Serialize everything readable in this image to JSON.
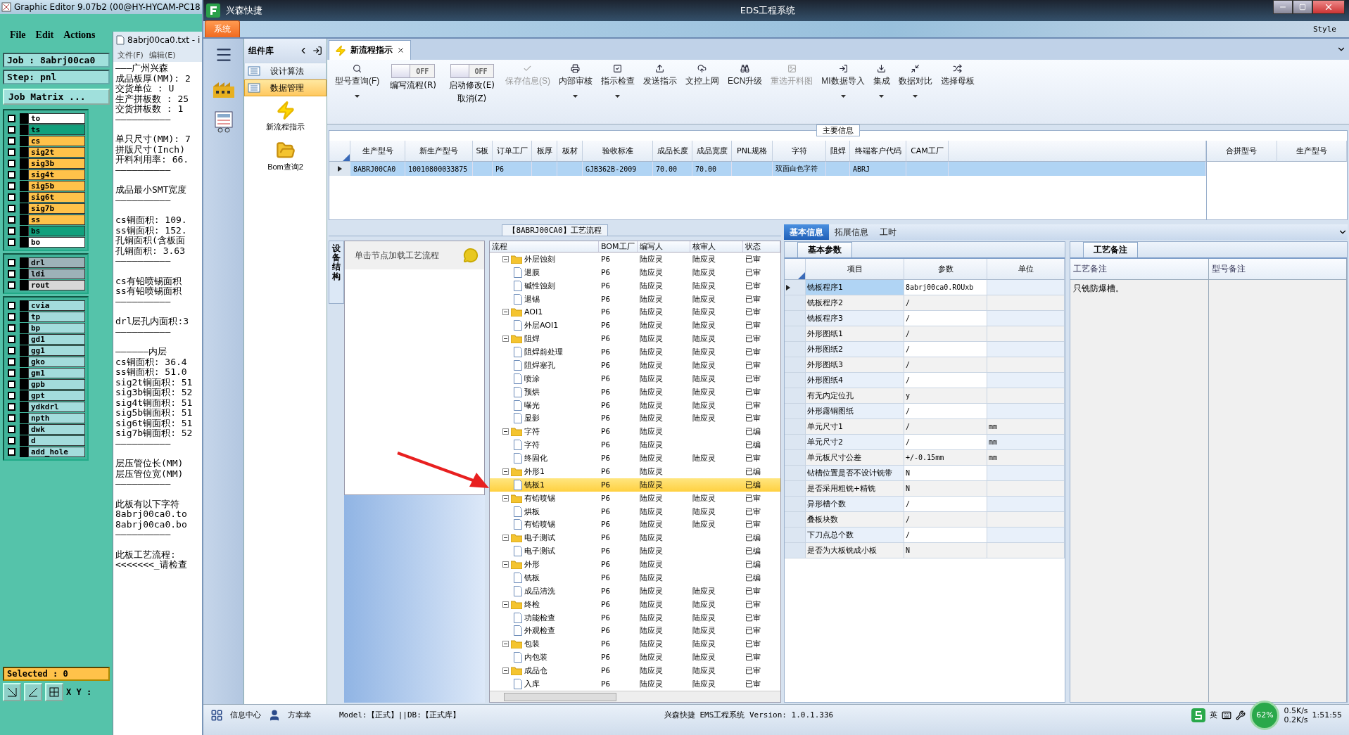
{
  "graphic_editor": {
    "title": "Graphic Editor 9.07b2 (00@HY-HYCAM-PC18",
    "menu": [
      "File",
      "Edit",
      "Actions"
    ],
    "job": "Job : 8abrj00ca0",
    "step": "Step: pnl",
    "matrix_button": "Job Matrix ...",
    "layer_groups": [
      [
        {
          "name": "to",
          "color": "#ffffff",
          "checked": false
        },
        {
          "name": "ts",
          "color": "#12a07c",
          "checked": false
        },
        {
          "name": "cs",
          "color": "#ffc24a",
          "checked": false
        },
        {
          "name": "sig2t",
          "color": "#ffc24a",
          "checked": false
        },
        {
          "name": "sig3b",
          "color": "#ffc24a",
          "checked": false
        },
        {
          "name": "sig4t",
          "color": "#ffc24a",
          "checked": false
        },
        {
          "name": "sig5b",
          "color": "#ffc24a",
          "checked": false
        },
        {
          "name": "sig6t",
          "color": "#ffc24a",
          "checked": false
        },
        {
          "name": "sig7b",
          "color": "#ffc24a",
          "checked": false
        },
        {
          "name": "ss",
          "color": "#ffc24a",
          "checked": false
        },
        {
          "name": "bs",
          "color": "#12a07c",
          "checked": false
        },
        {
          "name": "bo",
          "color": "#ffffff",
          "checked": false
        }
      ],
      [
        {
          "name": "drl",
          "color": "#9db2b8",
          "checked": false
        },
        {
          "name": "ldi",
          "color": "#9db2b8",
          "checked": false
        },
        {
          "name": "rout",
          "color": "#d8d8d8",
          "checked": false
        }
      ],
      [
        {
          "name": "cvia",
          "color": "#a3dcdc",
          "checked": false
        },
        {
          "name": "tp",
          "color": "#a3dcdc",
          "checked": false
        },
        {
          "name": "bp",
          "color": "#a3dcdc",
          "checked": false
        },
        {
          "name": "gd1",
          "color": "#a3dcdc",
          "checked": false
        },
        {
          "name": "gg1",
          "color": "#a3dcdc",
          "checked": false
        },
        {
          "name": "gko",
          "color": "#a3dcdc",
          "checked": false
        },
        {
          "name": "gm1",
          "color": "#a3dcdc",
          "checked": false
        },
        {
          "name": "gpb",
          "color": "#a3dcdc",
          "checked": false
        },
        {
          "name": "gpt",
          "color": "#a3dcdc",
          "checked": false
        },
        {
          "name": "ydkdrl",
          "color": "#a3dcdc",
          "checked": false
        },
        {
          "name": "npth",
          "color": "#a3dcdc",
          "checked": false
        },
        {
          "name": "dwk",
          "color": "#a3dcdc",
          "checked": false
        },
        {
          "name": "d",
          "color": "#a3dcdc",
          "checked": false
        },
        {
          "name": "add_hole",
          "color": "#a3dcdc",
          "checked": false
        }
      ]
    ],
    "selected": "Selected : 0",
    "xy_label": "X Y :"
  },
  "text_window": {
    "title": "8abrj00ca0.txt - i",
    "menu": [
      "文件(F)",
      "编辑(E)"
    ],
    "blocks": [
      [
        "———广州兴森",
        "成品板厚(MM): 2",
        "交货单位 : U",
        "生产拼板数 : 25",
        "交货拼板数 : 1",
        "——————————"
      ],
      [
        "单只尺寸(MM): 7",
        "拼版尺寸(Inch)",
        "开料利用率: 66.",
        "——————————"
      ],
      [
        "成品最小SMT宽度",
        "——————————"
      ],
      [
        "cs铜面积: 109.",
        "ss铜面积: 152.",
        "孔铜面积(含板面",
        "孔铜面积: 3.63",
        "——————————"
      ],
      [
        "cs有铅喷锡面积",
        "ss有铅喷锡面积",
        "——————————"
      ],
      [
        "drl层孔内面积:3",
        "——————————"
      ],
      [
        "——————内层",
        "cs铜面积: 36.4",
        "ss铜面积: 51.0",
        "sig2t铜面积: 51",
        "sig3b铜面积: 52",
        "sig4t铜面积: 51",
        "sig5b铜面积: 51",
        "sig6t铜面积: 51",
        "sig7b铜面积: 52",
        "——————————"
      ],
      [
        "层压管位长(MM)",
        "层压管位宽(MM)",
        "——————————"
      ],
      [
        "此板有以下字符",
        "8abrj00ca0.to",
        "8abrj00ca0.bo",
        "——————————"
      ],
      [
        "此板工艺流程: ",
        "<<<<<<<_请检查"
      ]
    ]
  },
  "eds": {
    "app_name": "兴森快捷",
    "title": "EDS工程系统",
    "style_label": "Style",
    "ribbon_tab": "系统",
    "components": {
      "title": "组件库",
      "items": [
        {
          "label": "设计算法",
          "selected": false
        },
        {
          "label": "数据管理",
          "selected": true
        }
      ],
      "tools": [
        "新流程指示",
        "Bom查询2"
      ]
    },
    "doc_tab": "新流程指示",
    "toolbar": [
      {
        "kind": "button",
        "label": "型号查询(F)",
        "disabled": false,
        "dropdown": true
      },
      {
        "kind": "toggle",
        "label": "编写流程(R)",
        "state_text": "OFF",
        "on": false
      },
      {
        "kind": "toggle",
        "label": "启动修改(E)",
        "label2": "取消(Z)",
        "state_text": "OFF",
        "on": false
      },
      {
        "kind": "button",
        "label": "保存信息(S)",
        "disabled": true,
        "dropdown": false
      },
      {
        "kind": "button",
        "label": "内部审核",
        "disabled": false,
        "dropdown": true
      },
      {
        "kind": "button",
        "label": "指示检查",
        "disabled": false,
        "dropdown": true
      },
      {
        "kind": "button",
        "label": "发送指示",
        "disabled": false,
        "dropdown": false
      },
      {
        "kind": "button",
        "label": "文控上网",
        "disabled": false,
        "dropdown": false
      },
      {
        "kind": "button",
        "label": "ECN升级",
        "disabled": false,
        "dropdown": false
      },
      {
        "kind": "button",
        "label": "重选开料图",
        "disabled": true,
        "dropdown": false
      },
      {
        "kind": "button",
        "label": "MI数据导入",
        "disabled": false,
        "dropdown": true
      },
      {
        "kind": "button",
        "label": "集成",
        "disabled": false,
        "dropdown": true
      },
      {
        "kind": "button",
        "label": "数据对比",
        "disabled": false,
        "dropdown": true
      },
      {
        "kind": "button",
        "label": "选择母板",
        "disabled": false,
        "dropdown": false
      }
    ],
    "main_info": {
      "title": "主要信息",
      "columns": [
        "生产型号",
        "新生产型号",
        "S板",
        "订单工厂",
        "板厚",
        "板材",
        "验收标准",
        "成品长度",
        "成品宽度",
        "PNL规格",
        "字符",
        "阻焊",
        "终端客户代码",
        "CAM工厂"
      ],
      "rows": [
        {
          "selected": true,
          "cells": [
            "8ABRJ00CA0",
            "10010800033875",
            "",
            "P6",
            "",
            "",
            "GJB362B-2009",
            "70.00",
            "70.00",
            "",
            "双面白色字符",
            "",
            "ABRJ",
            ""
          ]
        }
      ],
      "side_columns": [
        "合拼型号",
        "生产型号"
      ]
    },
    "side_tab": "设备结构",
    "hint": "单击节点加载工艺流程",
    "flow": {
      "title": "【8ABRJ00CA0】工艺流程",
      "columns": [
        "流程",
        "BOM工厂",
        "编写人",
        "核审人",
        "状态"
      ],
      "nodes": [
        {
          "label": "外层蚀刻",
          "factory": "P6",
          "writer": "陆应灵",
          "reviewer": "陆应灵",
          "status": "已审",
          "selected": false,
          "children": [
            {
              "label": "退膜",
              "factory": "P6",
              "writer": "陆应灵",
              "reviewer": "陆应灵",
              "status": "已审",
              "selected": false
            },
            {
              "label": "碱性蚀刻",
              "factory": "P6",
              "writer": "陆应灵",
              "reviewer": "陆应灵",
              "status": "已审",
              "selected": false
            },
            {
              "label": "退锡",
              "factory": "P6",
              "writer": "陆应灵",
              "reviewer": "陆应灵",
              "status": "已审",
              "selected": false
            }
          ]
        },
        {
          "label": "AOI1",
          "factory": "P6",
          "writer": "陆应灵",
          "reviewer": "陆应灵",
          "status": "已审",
          "selected": false,
          "children": [
            {
              "label": "外层AOI1",
              "factory": "P6",
              "writer": "陆应灵",
              "reviewer": "陆应灵",
              "status": "已审",
              "selected": false
            }
          ]
        },
        {
          "label": "阻焊",
          "factory": "P6",
          "writer": "陆应灵",
          "reviewer": "陆应灵",
          "status": "已审",
          "selected": false,
          "children": [
            {
              "label": "阻焊前处理",
              "factory": "P6",
              "writer": "陆应灵",
              "reviewer": "陆应灵",
              "status": "已审",
              "selected": false
            },
            {
              "label": "阻焊塞孔",
              "factory": "P6",
              "writer": "陆应灵",
              "reviewer": "陆应灵",
              "status": "已审",
              "selected": false
            },
            {
              "label": "喷涂",
              "factory": "P6",
              "writer": "陆应灵",
              "reviewer": "陆应灵",
              "status": "已审",
              "selected": false
            },
            {
              "label": "预烘",
              "factory": "P6",
              "writer": "陆应灵",
              "reviewer": "陆应灵",
              "status": "已审",
              "selected": false
            },
            {
              "label": "曝光",
              "factory": "P6",
              "writer": "陆应灵",
              "reviewer": "陆应灵",
              "status": "已审",
              "selected": false
            },
            {
              "label": "显影",
              "factory": "P6",
              "writer": "陆应灵",
              "reviewer": "陆应灵",
              "status": "已审",
              "selected": false
            }
          ]
        },
        {
          "label": "字符",
          "factory": "P6",
          "writer": "陆应灵",
          "status": "已编",
          "selected": false,
          "children": [
            {
              "label": "字符",
              "factory": "P6",
              "writer": "陆应灵",
              "status": "已编",
              "selected": false
            },
            {
              "label": "终固化",
              "factory": "P6",
              "writer": "陆应灵",
              "reviewer": "陆应灵",
              "status": "已审",
              "selected": false
            }
          ]
        },
        {
          "label": "外形1",
          "factory": "P6",
          "writer": "陆应灵",
          "status": "已编",
          "selected": false,
          "children": [
            {
              "label": "铣板1",
              "factory": "P6",
              "writer": "陆应灵",
              "status": "已编",
              "selected": true
            }
          ]
        },
        {
          "label": "有铅喷锡",
          "factory": "P6",
          "writer": "陆应灵",
          "reviewer": "陆应灵",
          "status": "已审",
          "selected": false,
          "children": [
            {
              "label": "烘板",
              "factory": "P6",
              "writer": "陆应灵",
              "reviewer": "陆应灵",
              "status": "已审",
              "selected": false
            },
            {
              "label": "有铅喷锡",
              "factory": "P6",
              "writer": "陆应灵",
              "reviewer": "陆应灵",
              "status": "已审",
              "selected": false
            }
          ]
        },
        {
          "label": "电子测试",
          "factory": "P6",
          "writer": "陆应灵",
          "status": "已编",
          "selected": false,
          "children": [
            {
              "label": "电子测试",
              "factory": "P6",
              "writer": "陆应灵",
              "status": "已编",
              "selected": false
            }
          ]
        },
        {
          "label": "外形",
          "factory": "P6",
          "writer": "陆应灵",
          "status": "已编",
          "selected": false,
          "children": [
            {
              "label": "铣板",
              "factory": "P6",
              "writer": "陆应灵",
              "status": "已编",
              "selected": false
            },
            {
              "label": "成品清洗",
              "factory": "P6",
              "writer": "陆应灵",
              "reviewer": "陆应灵",
              "status": "已审",
              "selected": false
            }
          ]
        },
        {
          "label": "终检",
          "factory": "P6",
          "writer": "陆应灵",
          "reviewer": "陆应灵",
          "status": "已审",
          "selected": false,
          "children": [
            {
              "label": "功能检查",
              "factory": "P6",
              "writer": "陆应灵",
              "reviewer": "陆应灵",
              "status": "已审",
              "selected": false
            },
            {
              "label": "外观检查",
              "factory": "P6",
              "writer": "陆应灵",
              "reviewer": "陆应灵",
              "status": "已审",
              "selected": false
            }
          ]
        },
        {
          "label": "包装",
          "factory": "P6",
          "writer": "陆应灵",
          "reviewer": "陆应灵",
          "status": "已审",
          "selected": false,
          "children": [
            {
              "label": "内包装",
              "factory": "P6",
              "writer": "陆应灵",
              "reviewer": "陆应灵",
              "status": "已审",
              "selected": false
            }
          ]
        },
        {
          "label": "成品仓",
          "factory": "P6",
          "writer": "陆应灵",
          "reviewer": "陆应灵",
          "status": "已审",
          "selected": false,
          "children": [
            {
              "label": "入库",
              "factory": "P6",
              "writer": "陆应灵",
              "reviewer": "陆应灵",
              "status": "已审",
              "selected": false
            }
          ]
        }
      ]
    },
    "detail_tabs": [
      {
        "label": "基本信息",
        "selected": true
      },
      {
        "label": "拓展信息",
        "selected": false
      },
      {
        "label": "工时",
        "selected": false
      }
    ],
    "params": {
      "tab": "基本参数",
      "columns": [
        "项目",
        "参数",
        "单位"
      ],
      "rows": [
        {
          "item": "铣板程序1",
          "value": "8abrj00ca0.ROUxb",
          "selected": true
        },
        {
          "item": "铣板程序2",
          "value": "/",
          "selected": false
        },
        {
          "item": "铣板程序3",
          "value": "/",
          "selected": false
        },
        {
          "item": "外形图纸1",
          "value": "/",
          "selected": false
        },
        {
          "item": "外形图纸2",
          "value": "/",
          "selected": false
        },
        {
          "item": "外形图纸3",
          "value": "/",
          "selected": false
        },
        {
          "item": "外形图纸4",
          "value": "/",
          "selected": false
        },
        {
          "item": "有无内定位孔",
          "value": "y",
          "selected": false
        },
        {
          "item": "外形露铜图纸",
          "value": "/",
          "selected": false
        },
        {
          "item": "单元尺寸1",
          "value": "/",
          "unit": "mm",
          "selected": false
        },
        {
          "item": "单元尺寸2",
          "value": "/",
          "unit": "mm",
          "selected": false
        },
        {
          "item": "单元板尺寸公差",
          "value": "+/-0.15mm",
          "unit": "mm",
          "selected": false
        },
        {
          "item": "钻槽位置是否不设计铣带",
          "value": "N",
          "selected": false
        },
        {
          "item": "是否采用粗铣+精铣",
          "value": "N",
          "selected": false
        },
        {
          "item": "异形槽个数",
          "value": "/",
          "selected": false
        },
        {
          "item": "叠板块数",
          "value": "/",
          "selected": false
        },
        {
          "item": "下刀点总个数",
          "value": "/",
          "selected": false
        },
        {
          "item": "是否为大板铣成小板",
          "value": "N",
          "selected": false
        }
      ]
    },
    "notes": {
      "tab": "工艺备注",
      "columns": [
        "工艺备注",
        "型号备注"
      ],
      "process_note": "只铣防爆槽。"
    },
    "status_bar": {
      "info": "信息中心",
      "user": "方幸幸",
      "model": "Model:【正式】||DB:【正式库】",
      "version": "兴森快捷 EMS工程系统 Version: 1.0.1.336"
    },
    "tray": {
      "ime": "英",
      "meter": "62%",
      "up": "0.5K/s",
      "down": "0.2K/s",
      "clock": "1:51:55"
    }
  }
}
